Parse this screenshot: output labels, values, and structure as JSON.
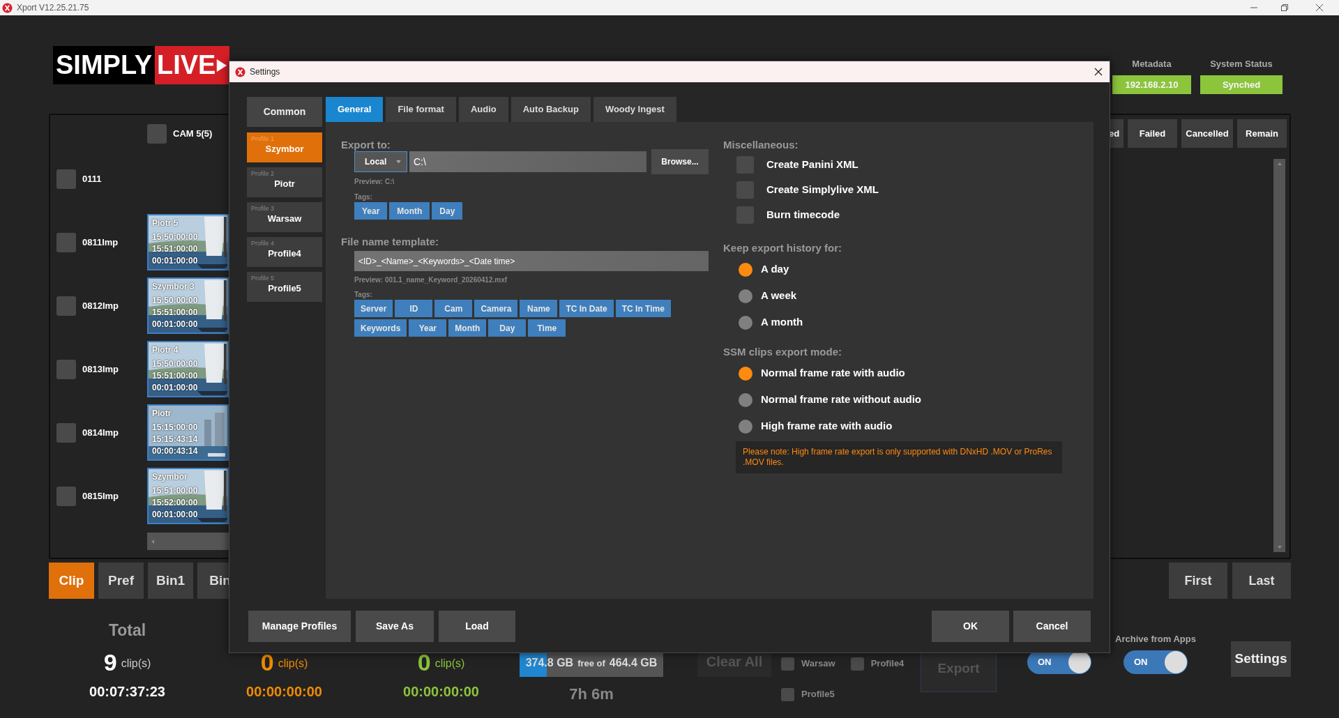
{
  "window": {
    "title": "Xport V12.25.21.75"
  },
  "logo": {
    "text_1": "SIMPLY",
    "text_2": "LIVE"
  },
  "header": {
    "metadata": {
      "label": "Metadata",
      "value": "192.168.2.10"
    },
    "system_status": {
      "label": "System Status",
      "value": "Synched"
    }
  },
  "camera": {
    "label": "CAM 5(5)",
    "checked": false
  },
  "clip_rows": [
    {
      "name": "0111",
      "checked": false
    },
    {
      "name": "0811Imp",
      "checked": false,
      "clip": {
        "title": "Piotr 5",
        "times": [
          "15:50:00:00",
          "15:51:00:00",
          "00:01:00:00"
        ]
      }
    },
    {
      "name": "0812Imp",
      "checked": false,
      "clip": {
        "title": "Szymbor 3",
        "times": [
          "15:50:00:00",
          "15:51:00:00",
          "00:01:00:00"
        ]
      }
    },
    {
      "name": "0813Imp",
      "checked": false,
      "clip": {
        "title": "Piotr 4",
        "times": [
          "15:50:00:00",
          "15:51:00:00",
          "00:01:00:00"
        ]
      }
    },
    {
      "name": "0814Imp",
      "checked": false,
      "clip": {
        "title": "Piotr",
        "times": [
          "15:15:00:00",
          "15:15:43:14",
          "00:00:43:14"
        ]
      }
    },
    {
      "name": "0815Imp",
      "checked": false,
      "clip": {
        "title": "Szymbor",
        "times": [
          "15:51:00:00",
          "15:52:00:00",
          "00:01:00:00"
        ]
      }
    }
  ],
  "right_panel": {
    "columns": [
      "ed",
      "Failed",
      "Cancelled",
      "Remain"
    ]
  },
  "view_tabs": [
    {
      "label": "Clip",
      "selected": true
    },
    {
      "label": "Pref",
      "selected": false
    },
    {
      "label": "Bin1",
      "selected": false
    },
    {
      "label": "Bin",
      "selected": false
    }
  ],
  "nav_buttons": [
    "First",
    "Last"
  ],
  "totals": [
    {
      "kind": "total",
      "label": "Total",
      "count": "9",
      "unit": "clip(s)",
      "time": "00:07:37:23"
    },
    {
      "kind": "pending",
      "count": "0",
      "unit": "clip(s)",
      "time": "00:00:00:00"
    },
    {
      "kind": "done",
      "count": "0",
      "unit": "clip(s)",
      "time": "00:00:00:00"
    }
  ],
  "storage": {
    "free": "374.8 GB",
    "free_of": "free of",
    "total": "464.4 GB",
    "level": 0.19,
    "remaining": "7h 6m"
  },
  "clear_all": {
    "label": "Clear All",
    "disabled": true
  },
  "profile_checks": [
    {
      "label": "Warsaw",
      "checked": false
    },
    {
      "label": "Profile4",
      "checked": false
    },
    {
      "label": "Profile5",
      "checked": false
    }
  ],
  "export_button": {
    "label": "Export",
    "disabled": true
  },
  "toggles": [
    {
      "text": "ON",
      "on": true
    },
    {
      "label": "Archive from Apps",
      "text": "ON",
      "on": true
    }
  ],
  "settings_button": "Settings",
  "settings_dialog": {
    "title": "Settings",
    "common": "Common",
    "profiles": [
      {
        "caption": "Profile 1",
        "name": "Szymbor",
        "selected": true
      },
      {
        "caption": "Profile 2",
        "name": "Piotr",
        "selected": false
      },
      {
        "caption": "Profile 3",
        "name": "Warsaw",
        "selected": false
      },
      {
        "caption": "Profile 4",
        "name": "Profile4",
        "selected": false
      },
      {
        "caption": "Profile 5",
        "name": "Profile5",
        "selected": false
      }
    ],
    "tabs": [
      {
        "label": "General",
        "selected": true
      },
      {
        "label": "File format",
        "selected": false
      },
      {
        "label": "Audio",
        "selected": false
      },
      {
        "label": "Auto Backup",
        "selected": false
      },
      {
        "label": "Woody Ingest",
        "selected": false
      }
    ],
    "export_to": {
      "label": "Export to:",
      "destination": "Local",
      "path": "C:\\",
      "browse": "Browse...",
      "preview": "Preview: C:\\",
      "tags_label": "Tags:",
      "tags": [
        "Year",
        "Month",
        "Day"
      ]
    },
    "file_name_template": {
      "label": "File name template:",
      "value": "<ID>_<Name>_<Keywords>_<Date time>",
      "preview": "Preview: 001.1_name_Keyword_20260412.mxf",
      "tags_label": "Tags:",
      "tag_rows": [
        [
          "Server",
          "ID",
          "Cam",
          "Camera",
          "Name",
          "TC In Date",
          "TC In Time"
        ],
        [
          "Keywords",
          "Year",
          "Month",
          "Day",
          "Time"
        ]
      ]
    },
    "miscellaneous": {
      "label": "Miscellaneous:",
      "options": [
        {
          "label": "Create Panini XML",
          "checked": false
        },
        {
          "label": "Create Simplylive XML",
          "checked": false
        },
        {
          "label": "Burn timecode",
          "checked": false
        }
      ]
    },
    "history": {
      "label": "Keep export history for:",
      "options": [
        {
          "label": "A day",
          "selected": true
        },
        {
          "label": "A week",
          "selected": false
        },
        {
          "label": "A month",
          "selected": false
        }
      ]
    },
    "ssm_mode": {
      "label": "SSM clips export mode:",
      "options": [
        {
          "label": "Normal frame rate with audio",
          "selected": true
        },
        {
          "label": "Normal frame rate without audio",
          "selected": false
        },
        {
          "label": "High frame rate with audio",
          "selected": false
        }
      ]
    },
    "note": "Please note: High frame rate export is only supported with DNxHD .MOV or ProRes .MOV files.",
    "footer_left": [
      "Manage Profiles",
      "Save As",
      "Load"
    ],
    "footer_right": [
      "OK",
      "Cancel"
    ]
  }
}
